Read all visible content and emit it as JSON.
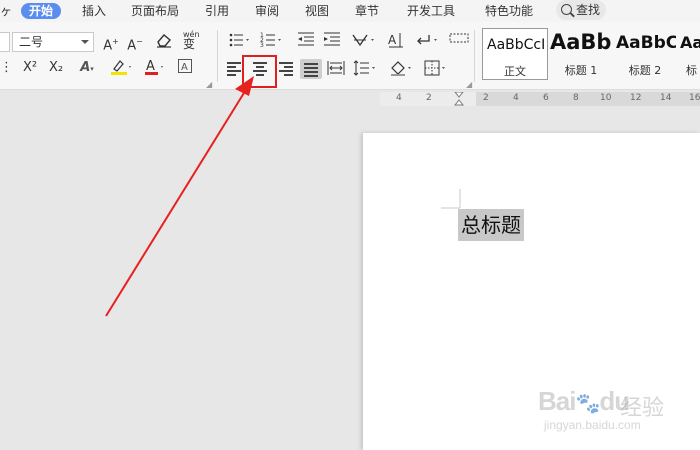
{
  "menubar": {
    "tabs": [
      {
        "label": "开始",
        "active": true
      },
      {
        "label": "插入"
      },
      {
        "label": "页面布局"
      },
      {
        "label": "引用"
      },
      {
        "label": "审阅"
      },
      {
        "label": "视图"
      },
      {
        "label": "章节"
      },
      {
        "label": "开发工具"
      },
      {
        "label": "特色功能"
      }
    ],
    "search_label": "查找"
  },
  "ribbon": {
    "font_size": "二号",
    "grow_font": "A⁺",
    "shrink_font": "A⁻",
    "superscript": "X²",
    "subscript": "X₂",
    "font_color_glyph": "A",
    "phonetic_glyph": "wén"
  },
  "styles": [
    {
      "sample": "AaBbCcI",
      "name": "正文",
      "selected": true
    },
    {
      "sample": "AaBb",
      "name": "标题 1"
    },
    {
      "sample": "AaBbC",
      "name": "标题 2"
    },
    {
      "sample": "AaB",
      "name": "标"
    }
  ],
  "ruler": {
    "numbers": [
      "4",
      "2",
      "2",
      "4",
      "6",
      "8",
      "10",
      "12",
      "14",
      "16"
    ]
  },
  "document": {
    "title_text": "总标题"
  },
  "watermark": {
    "logo": "Bai",
    "logo2": "du",
    "cn": "经验",
    "url": "jingyan.baidu.com"
  },
  "colors": {
    "accent": "#5b8def",
    "highlight": "#e02020",
    "selection": "#c8c8c8"
  }
}
